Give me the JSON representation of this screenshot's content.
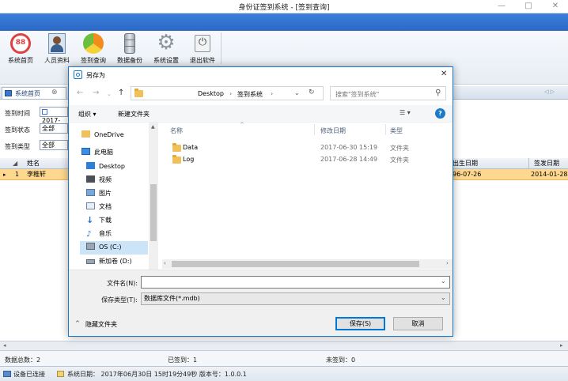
{
  "window": {
    "title": "身份证签到系统 - [签到查询]",
    "minimize": "—",
    "maximize": "□",
    "close": "✕"
  },
  "toolbar": {
    "items": [
      {
        "label": "系统首页",
        "icon": "home-88-icon"
      },
      {
        "label": "人员资料",
        "icon": "person-card-icon"
      },
      {
        "label": "签到查询",
        "icon": "pie-chart-icon"
      },
      {
        "label": "数据备份",
        "icon": "database-icon"
      },
      {
        "label": "系统设置",
        "icon": "gear-icon"
      },
      {
        "label": "退出软件",
        "icon": "power-icon"
      }
    ]
  },
  "tabs": {
    "home_label": "系统首页",
    "close": "⊗",
    "scroll": "◁ ▷"
  },
  "filters": {
    "time_label": "签到时间",
    "time_value": "2017-",
    "state_label": "签到状态",
    "state_value": "全部",
    "type_label": "签到类型",
    "type_value": "全部"
  },
  "grid": {
    "columns": {
      "name": "姓名",
      "birth": "出生日期",
      "issue": "签发日期"
    },
    "row": {
      "index": "1",
      "name": "李稚轩",
      "birth": "96-07-26",
      "issue": "2014-01-28"
    }
  },
  "status": {
    "total": "数据总数：2",
    "checked": "已签到：1",
    "unchecked": "未签到：0",
    "device": "设备已连接",
    "system": "系统日期： 2017年06月30日 15时19分49秒   版本号：1.0.0.1"
  },
  "dialog": {
    "title": "另存为",
    "close": "✕",
    "path": {
      "a": "Desktop",
      "sep1": "›",
      "b": "签到系统",
      "sep2": "›"
    },
    "search_placeholder": "搜索\"签到系统\"",
    "organize": "组织 ▾",
    "new_folder": "新建文件夹",
    "view": "☰ ▾",
    "help": "?",
    "nav": [
      {
        "label": "OneDrive",
        "icon": "onedrive-folder-icon"
      },
      {
        "label": "此电脑",
        "icon": "computer-icon"
      },
      {
        "label": "Desktop",
        "icon": "desktop-icon"
      },
      {
        "label": "视频",
        "icon": "video-icon"
      },
      {
        "label": "图片",
        "icon": "picture-icon"
      },
      {
        "label": "文档",
        "icon": "document-icon"
      },
      {
        "label": "下载",
        "icon": "download-icon"
      },
      {
        "label": "音乐",
        "icon": "music-icon"
      },
      {
        "label": "OS (C:)",
        "icon": "drive-c-icon"
      },
      {
        "label": "新加卷 (D:)",
        "icon": "drive-d-icon"
      }
    ],
    "columns": {
      "name": "名称",
      "date": "修改日期",
      "type": "类型"
    },
    "files": [
      {
        "name": "Data",
        "date": "2017-06-30 15:19",
        "type": "文件夹"
      },
      {
        "name": "Log",
        "date": "2017-06-28 14:49",
        "type": "文件夹"
      }
    ],
    "filename_label": "文件名(N):",
    "filename_value": "",
    "filetype_label": "保存类型(T):",
    "filetype_value": "数据库文件(*.mdb)",
    "hide_folders": "隐藏文件夹",
    "save": "保存(S)",
    "cancel": "取消"
  }
}
